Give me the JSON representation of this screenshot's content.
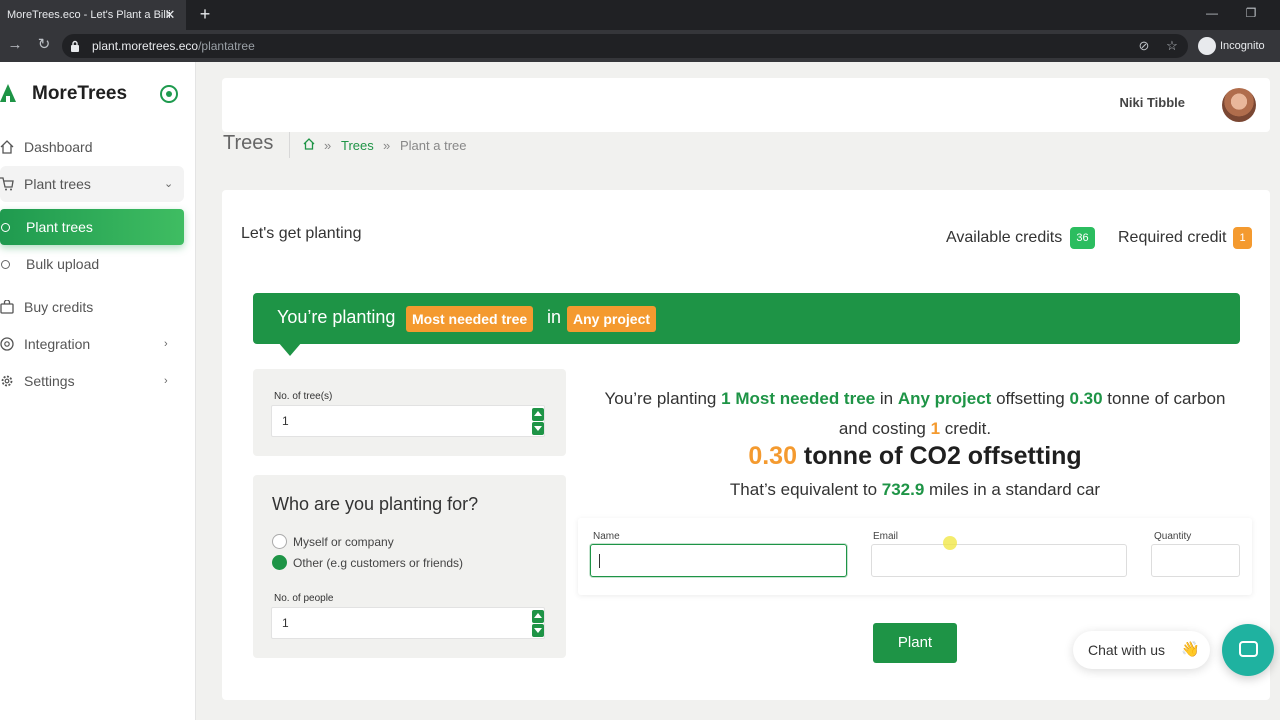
{
  "browser": {
    "tab_title": "MoreTrees.eco - Let's Plant a Billi",
    "tab_close": "✕",
    "new_tab": "+",
    "url_host": "plant.moretrees.eco",
    "url_path": "/plantatree",
    "incognito_label": "Incognito"
  },
  "sidebar": {
    "brand": "MoreTrees",
    "items": [
      {
        "label": "Dashboard"
      },
      {
        "label": "Plant trees"
      },
      {
        "label": "Plant trees"
      },
      {
        "label": "Bulk upload"
      },
      {
        "label": "Buy credits"
      },
      {
        "label": "Integration"
      },
      {
        "label": "Settings"
      }
    ]
  },
  "header": {
    "user_name": "Niki Tibble"
  },
  "breadcrumb": {
    "title": "Trees",
    "sep1": "»",
    "link": "Trees",
    "sep2": "»",
    "current": "Plant a tree"
  },
  "card": {
    "heading": "Let's get planting",
    "available_label": "Available credits",
    "available_value": "36",
    "required_label": "Required credit",
    "required_value": "1"
  },
  "banner": {
    "prefix": "You’re planting",
    "tree": "Most needed tree",
    "mid": "in",
    "project": "Any project"
  },
  "trees_panel": {
    "label": "No. of tree(s)",
    "value": "1"
  },
  "who_panel": {
    "title": "Who are you planting for?",
    "option1": "Myself or company",
    "option2": "Other (e.g customers or friends)",
    "people_label": "No. of people",
    "people_value": "1"
  },
  "summary": {
    "t1": "You’re planting ",
    "count": "1",
    "t2": " ",
    "tree": "Most needed tree",
    "t3": " in ",
    "project": "Any project",
    "t4": " offsetting ",
    "tonnes": "0.30",
    "t5": " tonne of carbon and costing ",
    "credits": "1",
    "t6": " credit."
  },
  "co2": {
    "value": "0.30",
    "text": " tonne of CO2 offsetting"
  },
  "equivalent": {
    "t1": "That’s equivalent to ",
    "miles": "732.9",
    "t2": " miles in a standard car"
  },
  "form": {
    "name_label": "Name",
    "email_label": "Email",
    "quantity_label": "Quantity"
  },
  "plant_button": "Plant",
  "chat": {
    "label": "Chat with us",
    "emoji": "👋"
  },
  "colors": {
    "brand_green": "#1e9446",
    "accent_orange": "#f49a2f",
    "chat_teal": "#1fb2a0"
  }
}
